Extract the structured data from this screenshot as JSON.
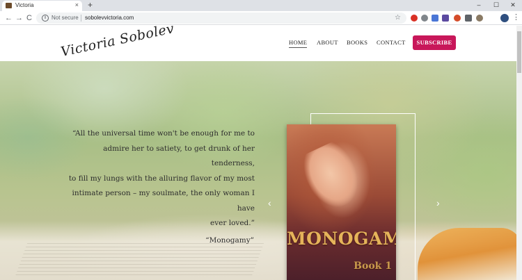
{
  "browser": {
    "tab": {
      "title": "Victoria"
    },
    "new_tab_symbol": "+",
    "tab_close_symbol": "×",
    "window_controls": {
      "minimize": "–",
      "maximize": "☐",
      "close": "✕"
    },
    "nav": {
      "back": "←",
      "forward": "→",
      "reload": "C"
    },
    "omnibox": {
      "info_symbol": "i",
      "security_label": "Not secure",
      "url": "sobolevvictoria.com",
      "bookmark_symbol": "☆"
    },
    "menu_symbol": "⋮",
    "extension_colors": [
      "#d93025",
      "#80868b",
      "#4a76d6",
      "#5b4aa0",
      "#d44c2a",
      "#5f6368",
      "#8a7a64"
    ]
  },
  "site": {
    "logo": "Victoria Sobolev",
    "nav": [
      {
        "label": "HOME",
        "active": true
      },
      {
        "label": "ABOUT",
        "active": false
      },
      {
        "label": "BOOKS",
        "active": false
      },
      {
        "label": "CONTACT",
        "active": false
      }
    ],
    "subscribe_label": "SUBSCRIBE",
    "accent_color": "#c8175a"
  },
  "hero": {
    "quote_lines": [
      "“All the universal time won't be enough for me to",
      "admire her to satiety, to get drunk of her tenderness,",
      "to fill my lungs with the alluring flavor of my most",
      "intimate person – my soulmate, the only woman I have",
      "ever loved.”"
    ],
    "quote_source": "“Monogamy”",
    "prev_arrow": "‹",
    "next_arrow": "›",
    "book": {
      "title": "MONOGAMY",
      "subtitle": "Book 1"
    }
  }
}
